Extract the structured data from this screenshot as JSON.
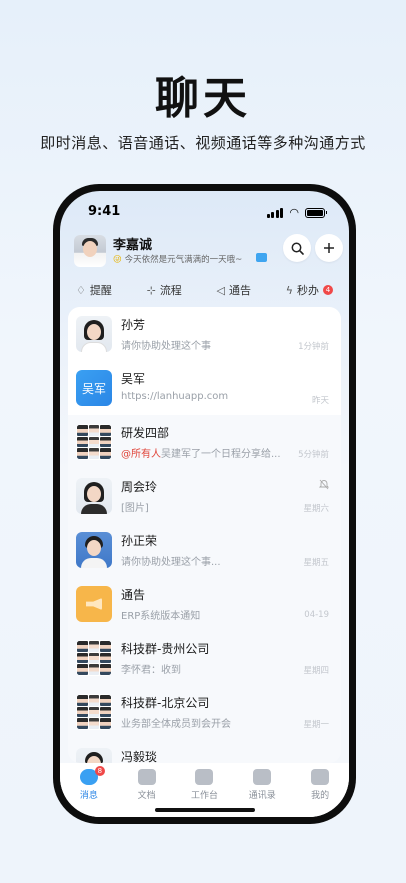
{
  "hero": {
    "title": "聊天",
    "subtitle": "即时消息、语音通话、视频通话等多种沟通方式"
  },
  "status_bar": {
    "time": "9:41"
  },
  "user": {
    "name": "李嘉诚",
    "status": "今天依然是元气满满的一天哦~",
    "status_emoji": "😜"
  },
  "quick_bar": [
    {
      "label": "提醒",
      "icon": "bell-icon"
    },
    {
      "label": "流程",
      "icon": "flow-icon"
    },
    {
      "label": "通告",
      "icon": "megaphone-icon"
    },
    {
      "label": "秒办",
      "icon": "lightning-icon",
      "badge": "4"
    }
  ],
  "conversations": [
    {
      "name": "孙芳",
      "message": "请你协助处理这个事",
      "time": "1分钟前"
    },
    {
      "name": "吴军",
      "avatar_text": "吴军",
      "message": "https://lanhuapp.com",
      "time": "昨天"
    },
    {
      "name": "研发四部",
      "mention": "@所有人",
      "message": "吴建军了一个日程分享给...",
      "time": "5分钟前"
    },
    {
      "name": "周会玲",
      "message": "[图片]",
      "time": "星期六",
      "muted": true
    },
    {
      "name": "孙正荣",
      "message": "请你协助处理这个事...",
      "time": "星期五"
    },
    {
      "name": "通告",
      "message": "ERP系统版本通知",
      "time": "04-19"
    },
    {
      "name": "科技群-贵州公司",
      "message": "李怀君：收到",
      "time": "星期四"
    },
    {
      "name": "科技群-北京公司",
      "message": "业务部全体成员到会开会",
      "time": "星期一"
    },
    {
      "name": "冯毅琰",
      "message": "",
      "time": ""
    }
  ],
  "tabbar": [
    {
      "label": "消息",
      "active": true,
      "badge": "8"
    },
    {
      "label": "文档"
    },
    {
      "label": "工作台"
    },
    {
      "label": "通讯录"
    },
    {
      "label": "我的"
    }
  ],
  "colors": {
    "accent": "#2b86e6",
    "badge": "#f04848",
    "mention": "#e0453a"
  }
}
